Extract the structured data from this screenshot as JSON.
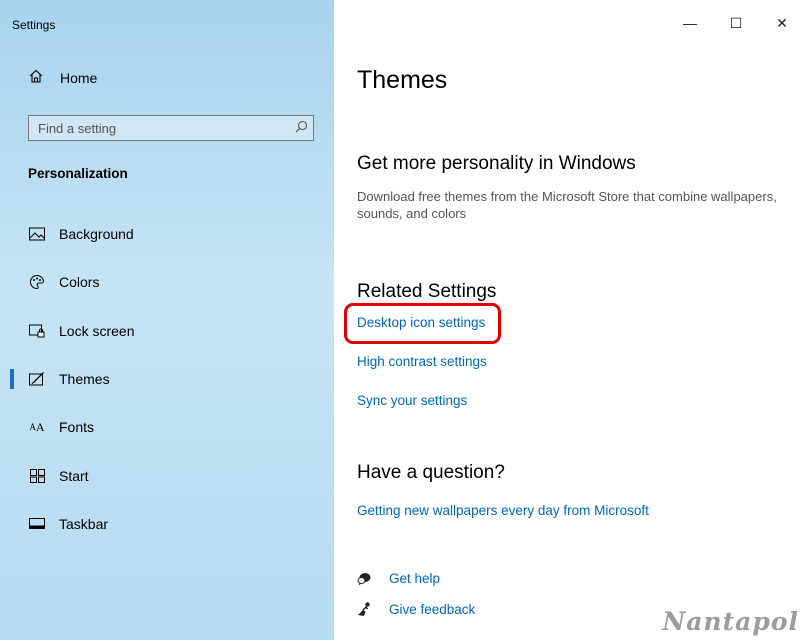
{
  "window": {
    "title": "Settings",
    "controls": {
      "minimize": "—",
      "maximize": "☐",
      "close": "✕"
    }
  },
  "sidebar": {
    "home_label": "Home",
    "search_placeholder": "Find a setting",
    "section_title": "Personalization",
    "items": [
      {
        "label": "Background",
        "icon": "image-icon"
      },
      {
        "label": "Colors",
        "icon": "palette-icon"
      },
      {
        "label": "Lock screen",
        "icon": "lock-screen-icon"
      },
      {
        "label": "Themes",
        "icon": "themes-icon",
        "selected": true
      },
      {
        "label": "Fonts",
        "icon": "fonts-icon"
      },
      {
        "label": "Start",
        "icon": "start-icon"
      },
      {
        "label": "Taskbar",
        "icon": "taskbar-icon"
      }
    ]
  },
  "main": {
    "page_title": "Themes",
    "personality": {
      "heading": "Get more personality in Windows",
      "description": "Download free themes from the Microsoft Store that combine wallpapers, sounds, and colors"
    },
    "related": {
      "heading": "Related Settings",
      "links": [
        "Desktop icon settings",
        "High contrast settings",
        "Sync your settings"
      ]
    },
    "question": {
      "heading": "Have a question?",
      "link": "Getting new wallpapers every day from Microsoft"
    },
    "help": {
      "get_help": "Get help",
      "give_feedback": "Give feedback"
    }
  },
  "annotation": {
    "highlight_color": "#e00000"
  },
  "watermark": "Nantapol",
  "colors": {
    "accent": "#0067b8",
    "selection_bar": "#1d6fb8"
  }
}
